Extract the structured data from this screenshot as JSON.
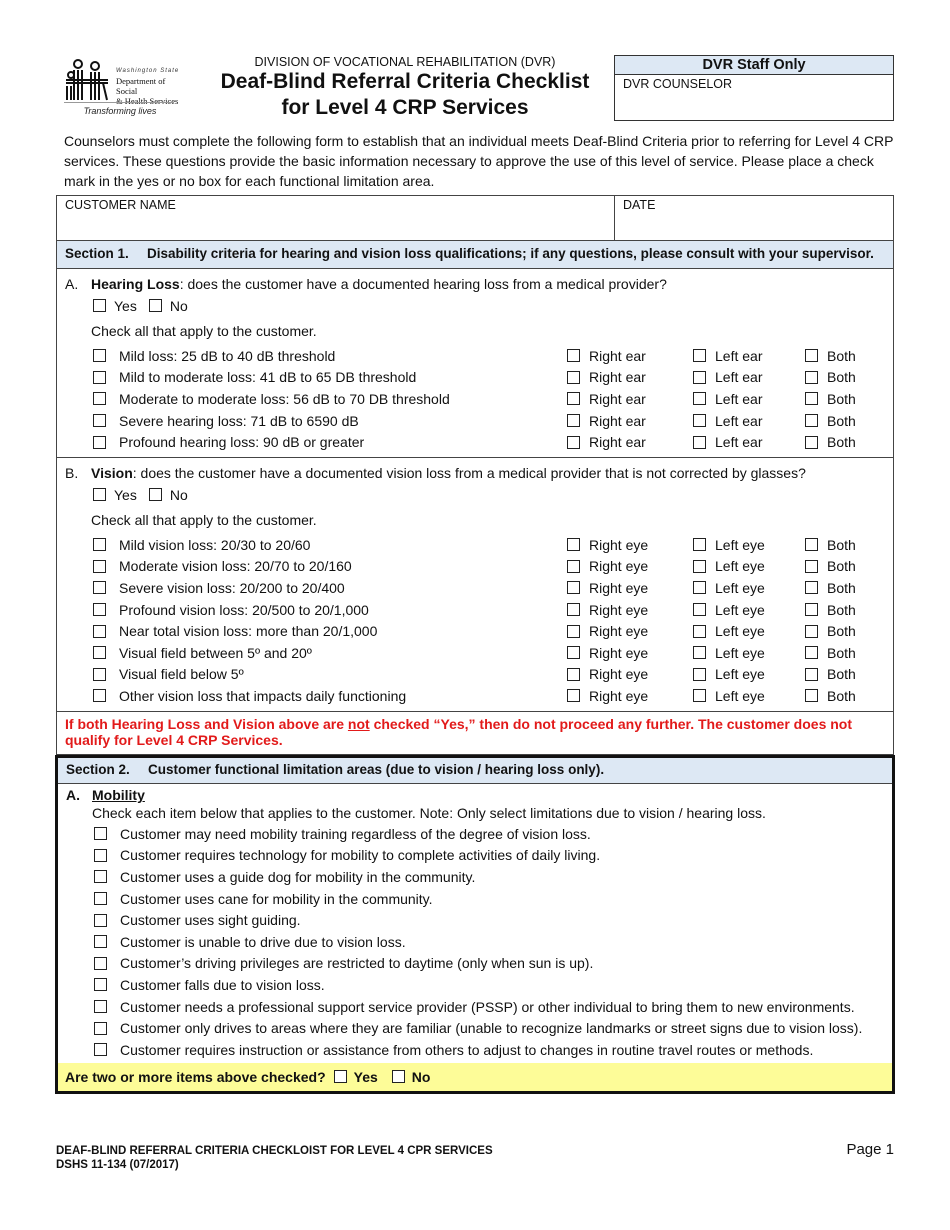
{
  "header": {
    "logo": {
      "icon": "family-figures-logo-icon",
      "state_label": "Washington State",
      "department_line1": "Department of Social",
      "department_line2": "& Health Services",
      "tagline": "Transforming lives"
    },
    "division": "DIVISION OF VOCATIONAL REHABILITATION (DVR)",
    "title_line1": "Deaf-Blind Referral Criteria Checklist",
    "title_line2": "for Level 4 CRP Services"
  },
  "staff_box": {
    "title": "DVR Staff Only",
    "counselor_label": "DVR COUNSELOR",
    "counselor_value": ""
  },
  "intro": "Counselors must complete the following form to establish that an individual meets Deaf-Blind Criteria prior to referring for Level 4 CRP services.  These questions provide the basic information necessary to approve the use of this level of service.  Please place a check mark in the yes or no box for each functional limitation area.",
  "customer": {
    "name_label": "CUSTOMER NAME",
    "name_value": "",
    "date_label": "DATE",
    "date_value": ""
  },
  "section1": {
    "number": "Section 1.",
    "title": "Disability criteria for hearing and vision loss qualifications; if any questions, please consult with your supervisor.",
    "hearing": {
      "letter": "A.",
      "label": "Hearing Loss",
      "question": ":  does the customer have a documented hearing loss from a medical provider?",
      "yes_label": "Yes",
      "no_label": "No",
      "check_all": "Check all that apply to the customer.",
      "side_labels": {
        "right": "Right ear",
        "left": "Left ear",
        "both": "Both"
      },
      "items": [
        "Mild loss:  25 dB to 40 dB threshold",
        "Mild to moderate loss:  41 dB to 65 DB threshold",
        "Moderate to moderate loss:  56 dB to 70 DB threshold",
        "Severe hearing loss:  71 dB to 6590 dB",
        "Profound hearing loss:  90 dB or greater"
      ]
    },
    "vision": {
      "letter": "B.",
      "label": "Vision",
      "question": ":  does the customer have a documented vision loss from a medical provider that is not corrected by glasses?",
      "yes_label": "Yes",
      "no_label": "No",
      "check_all": "Check all that apply to the customer.",
      "side_labels": {
        "right": "Right eye",
        "left": "Left eye",
        "both": "Both"
      },
      "items": [
        "Mild vision loss:  20/30 to 20/60",
        "Moderate vision loss:  20/70 to 20/160",
        "Severe vision loss:  20/200 to 20/400",
        "Profound vision loss:  20/500 to 20/1,000",
        "Near total vision loss:  more than 20/1,000",
        "Visual field between 5º and 20º",
        "Visual field below 5º",
        "Other vision loss that impacts daily functioning"
      ]
    },
    "warning": {
      "before": "If both Hearing Loss and Vision above are ",
      "underlined": "not",
      "after": " checked “Yes,” then do not proceed any further.  The customer does not qualify for Level 4 CRP Services.",
      "color": "#e21a1a"
    }
  },
  "section2": {
    "number": "Section 2.",
    "title": "Customer functional limitation areas (due to vision / hearing loss only).",
    "mobility": {
      "letter": "A.",
      "label": "Mobility",
      "note": "Check each item below that applies to the customer.  Note:  Only select limitations due to vision / hearing loss.",
      "items": [
        "Customer may need mobility training regardless of the degree of vision loss.",
        "Customer requires technology for mobility to complete activities of daily living.",
        "Customer uses a guide dog for mobility in the community.",
        "Customer uses cane for mobility in the community.",
        "Customer uses sight guiding.",
        "Customer is unable to drive due to vision loss.",
        "Customer’s driving privileges are restricted to daytime (only when sun is up).",
        "Customer falls due to vision loss.",
        "Customer needs a professional support service provider (PSSP) or other individual to bring them to new environments.",
        "Customer only drives to areas where they are familiar (unable to recognize landmarks or street signs due to vision loss).",
        "Customer requires instruction or assistance from others to adjust to changes in routine travel routes or methods."
      ],
      "two_more_question": "Are two or more items above checked?",
      "yes_label": "Yes",
      "no_label": "No"
    }
  },
  "colors": {
    "section_header_bg": "#dde8f4",
    "highlight_bg": "#fdfc98",
    "warning_text": "#e21a1a"
  },
  "footer": {
    "form_title": "DEAF-BLIND REFERRAL CRITERIA CHECKLOIST FOR LEVEL 4 CPR SERVICES",
    "form_number": "DSHS 11-134 (07/2017)",
    "page": "Page 1"
  }
}
